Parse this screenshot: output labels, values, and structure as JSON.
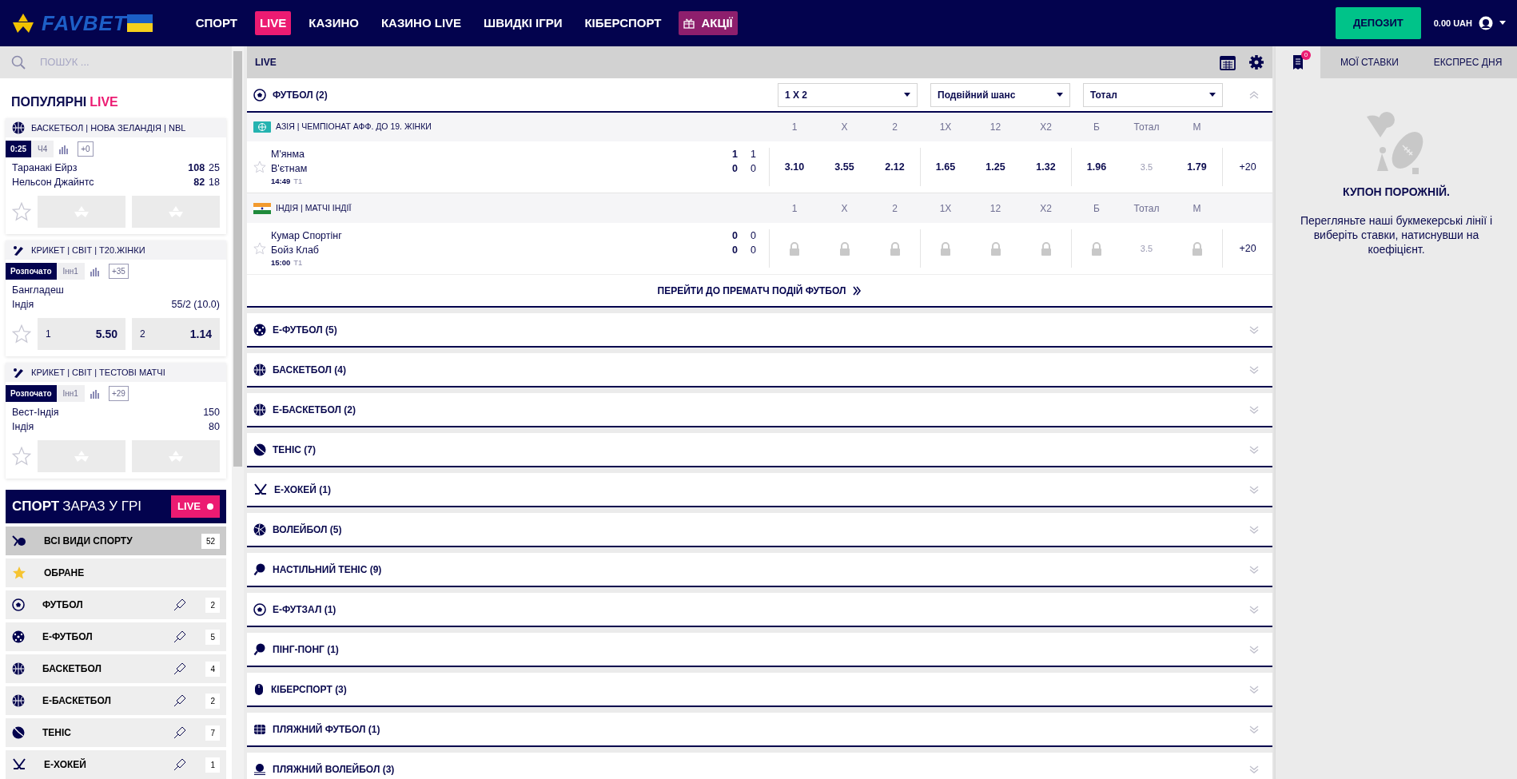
{
  "header": {
    "logo": "FAVBET",
    "nav": [
      {
        "label": "СПОРТ",
        "selected": false,
        "kind": "link"
      },
      {
        "label": "LIVE",
        "selected": true,
        "kind": "link"
      },
      {
        "label": "КАЗИНО",
        "selected": false,
        "kind": "link"
      },
      {
        "label": "КАЗИНО LIVE",
        "selected": false,
        "kind": "link"
      },
      {
        "label": "ШВИДКІ ІГРИ",
        "selected": false,
        "kind": "link"
      },
      {
        "label": "КІБЕРСПОРТ",
        "selected": false,
        "kind": "link"
      },
      {
        "label": "АКЦІЇ",
        "selected": false,
        "kind": "promo"
      }
    ],
    "deposit": "ДЕПОЗИТ",
    "balance": "0.00 UAH"
  },
  "sidebar": {
    "search": {
      "placeholder": "ПОШУК ..."
    },
    "popular_title": "ПОПУЛЯРНІ",
    "popular_badge": "LIVE",
    "popular_events": [
      {
        "kind": "basketball",
        "league": "БАСКЕТБОЛ | НОВА ЗЕЛАНДІЯ | NBL",
        "status": "0:25",
        "period": "Ч4",
        "more": "+0",
        "teams": [
          {
            "name": "Таранакі Ейрз",
            "score": "108",
            "sub": "25"
          },
          {
            "name": "Нельсон Джайнтс",
            "score": "82",
            "sub": "18"
          }
        ],
        "odds": [
          {
            "locked": true
          },
          {
            "locked": true
          }
        ]
      },
      {
        "kind": "cricket",
        "league": "КРИКЕТ | СВІТ | T20.ЖІНКИ",
        "status": "Розпочато",
        "period": "Інн1",
        "more": "+35",
        "teams": [
          {
            "name": "Бангладеш"
          },
          {
            "name": "Індія",
            "sub": "55/2 (10.0)"
          }
        ],
        "odds": [
          {
            "label": "1",
            "value": "5.50",
            "locked": false
          },
          {
            "label": "2",
            "value": "1.14",
            "locked": false
          }
        ]
      },
      {
        "kind": "cricket",
        "league": "КРИКЕТ | СВІТ | ТЕСТОВІ МАТЧІ",
        "status": "Розпочато",
        "period": "Інн1",
        "more": "+29",
        "teams": [
          {
            "name": "Вест-Індія",
            "sub": "150"
          },
          {
            "name": "Індія",
            "sub": "80"
          }
        ],
        "odds": [
          {
            "locked": true
          },
          {
            "locked": true
          }
        ]
      }
    ],
    "live_sports": {
      "title": "СПОРТ",
      "subtitle": "ЗАРАЗ У ГРІ",
      "badge": "LIVE",
      "items": [
        {
          "kind": "all",
          "label": "ВСІ ВИДИ СПОРТУ",
          "count": "52",
          "selected": true,
          "pinnable": false
        },
        {
          "kind": "star",
          "label": "ОБРАНЕ",
          "selected": false,
          "pinnable": false
        },
        {
          "kind": "football",
          "label": "ФУТБОЛ",
          "count": "2",
          "selected": false,
          "pinnable": true
        },
        {
          "kind": "efootball",
          "label": "Е-ФУТБОЛ",
          "count": "5",
          "selected": false,
          "pinnable": true
        },
        {
          "kind": "basketball",
          "label": "БАСКЕТБОЛ",
          "count": "4",
          "selected": false,
          "pinnable": true
        },
        {
          "kind": "ebasketball",
          "label": "Е-БАСКЕТБОЛ",
          "count": "2",
          "selected": false,
          "pinnable": true
        },
        {
          "kind": "tennis",
          "label": "ТЕНІС",
          "count": "7",
          "selected": false,
          "pinnable": true
        },
        {
          "kind": "hockey",
          "label": "Е-ХОКЕЙ",
          "count": "1",
          "selected": false,
          "pinnable": true
        }
      ]
    }
  },
  "main": {
    "title": "LIVE",
    "sections": [
      {
        "kind": "football",
        "label": "ФУТБОЛ (2)",
        "expanded": true,
        "markets": [
          "1 X 2",
          "Подвійний шанс",
          "Тотал"
        ],
        "leagues": [
          {
            "kind": "asia",
            "name": "АЗІЯ | ЧЕМПІОНАТ АФФ. ДО 19. ЖІНКИ",
            "columns": [
              "1",
              "X",
              "2",
              "1X",
              "12",
              "X2",
              "Б",
              "Тотал",
              "М"
            ],
            "events": [
              {
                "teams": [
                  {
                    "name": "М'янма",
                    "score": "1",
                    "sub": "1"
                  },
                  {
                    "name": "В'єтнам",
                    "score": "0",
                    "sub": "0"
                  }
                ],
                "time": "14:49",
                "period": "T1",
                "more": "+20",
                "odds": [
                  {
                    "kind": "odd",
                    "value": "3.10"
                  },
                  {
                    "kind": "odd",
                    "value": "3.55"
                  },
                  {
                    "kind": "odd",
                    "value": "2.12"
                  },
                  {
                    "kind": "odd",
                    "value": "1.65"
                  },
                  {
                    "kind": "odd",
                    "value": "1.25"
                  },
                  {
                    "kind": "odd",
                    "value": "1.32"
                  },
                  {
                    "kind": "odd",
                    "value": "1.96"
                  },
                  {
                    "kind": "line",
                    "value": "3.5"
                  },
                  {
                    "kind": "odd",
                    "value": "1.79"
                  }
                ]
              }
            ]
          },
          {
            "kind": "india",
            "name": "ІНДІЯ | МАТЧІ ІНДІЇ",
            "columns": [
              "1",
              "X",
              "2",
              "1X",
              "12",
              "X2",
              "Б",
              "Тотал",
              "М"
            ],
            "events": [
              {
                "teams": [
                  {
                    "name": "Кумар Спортінг",
                    "score": "0",
                    "sub": "0"
                  },
                  {
                    "name": "Бойз Клаб",
                    "score": "0",
                    "sub": "0"
                  }
                ],
                "time": "15:00",
                "period": "T1",
                "more": "+20",
                "odds": [
                  {
                    "kind": "locked"
                  },
                  {
                    "kind": "locked"
                  },
                  {
                    "kind": "locked"
                  },
                  {
                    "kind": "locked"
                  },
                  {
                    "kind": "locked"
                  },
                  {
                    "kind": "locked"
                  },
                  {
                    "kind": "locked"
                  },
                  {
                    "kind": "line",
                    "value": "3.5"
                  },
                  {
                    "kind": "locked"
                  }
                ]
              }
            ]
          }
        ],
        "link": "ПЕРЕЙТИ ДО ПРЕМАТЧ ПОДІЙ ФУТБОЛ"
      },
      {
        "kind": "efootball",
        "label": "Е-ФУТБОЛ (5)",
        "expanded": false
      },
      {
        "kind": "basketball",
        "label": "БАСКЕТБОЛ (4)",
        "expanded": false
      },
      {
        "kind": "ebasketball",
        "label": "Е-БАСКЕТБОЛ (2)",
        "expanded": false
      },
      {
        "kind": "tennis",
        "label": "ТЕНІС (7)",
        "expanded": false
      },
      {
        "kind": "hockey",
        "label": "Е-ХОКЕЙ (1)",
        "expanded": false
      },
      {
        "kind": "volleyball",
        "label": "ВОЛЕЙБОЛ (5)",
        "expanded": false
      },
      {
        "kind": "tabletennis",
        "label": "НАСТІЛЬНИЙ ТЕНІС (9)",
        "expanded": false
      },
      {
        "kind": "futsal",
        "label": "Е-ФУТЗАЛ (1)",
        "expanded": false
      },
      {
        "kind": "tabletennis",
        "label": "ПІНГ-ПОНГ (1)",
        "expanded": false
      },
      {
        "kind": "esports",
        "label": "КІБЕРСПОРТ (3)",
        "expanded": false
      },
      {
        "kind": "beachsoccer",
        "label": "ПЛЯЖНИЙ ФУТБОЛ (1)",
        "expanded": false
      },
      {
        "kind": "beachvolley",
        "label": "ПЛЯЖНИЙ ВОЛЕЙБОЛ (3)",
        "expanded": false
      }
    ]
  },
  "betslip": {
    "tabs": [
      {
        "kind": "coupon",
        "count": "0",
        "selected": true
      },
      {
        "kind": "text",
        "label": "МОЇ СТАВКИ",
        "selected": false
      },
      {
        "kind": "text",
        "label": "ЕКСПРЕС ДНЯ",
        "selected": false
      }
    ],
    "empty_title": "КУПОН ПОРОЖНІЙ.",
    "empty_text": "Перегляньте наші букмекерські лінії і виберіть ставки, натиснувши на коефіцієнт."
  }
}
